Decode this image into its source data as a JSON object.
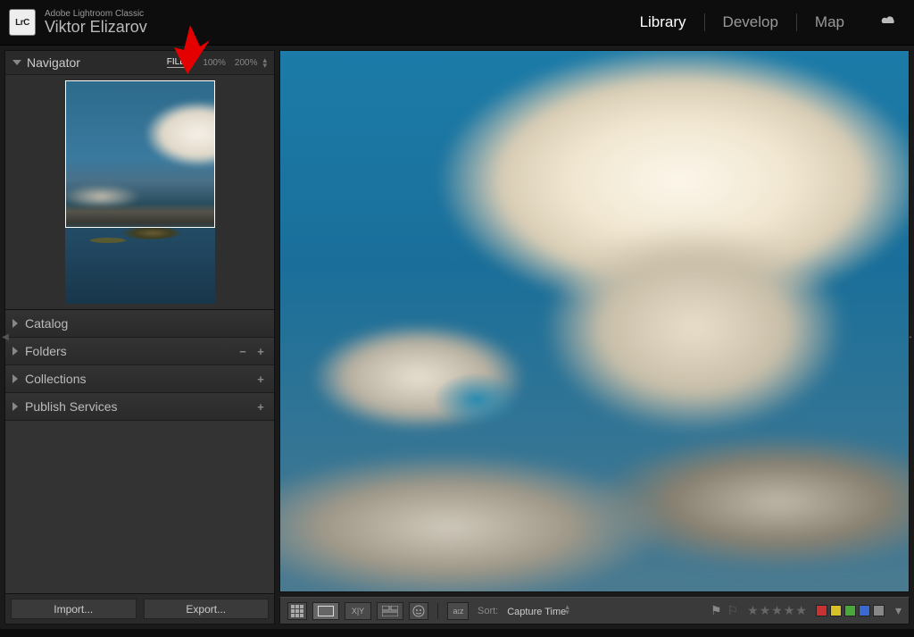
{
  "header": {
    "app_name": "Adobe Lightroom Classic",
    "logo_text": "LrC",
    "user_name": "Viktor Elizarov",
    "modules": [
      {
        "label": "Library",
        "active": true
      },
      {
        "label": "Develop",
        "active": false
      },
      {
        "label": "Map",
        "active": false
      }
    ]
  },
  "navigator": {
    "title": "Navigator",
    "zoom_options": [
      "FILL",
      "100%",
      "200%"
    ],
    "zoom_selected": "FILL"
  },
  "panels": [
    {
      "label": "Catalog",
      "icons": []
    },
    {
      "label": "Folders",
      "icons": [
        "−",
        "+"
      ]
    },
    {
      "label": "Collections",
      "icons": [
        "+"
      ]
    },
    {
      "label": "Publish Services",
      "icons": [
        "+"
      ]
    }
  ],
  "buttons": {
    "import": "Import...",
    "export": "Export..."
  },
  "toolbar": {
    "sort_label": "Sort:",
    "sort_value": "Capture Time",
    "color_swatches": [
      "#c83232",
      "#d8c028",
      "#4aa83a",
      "#3a6ad0",
      "#888888"
    ]
  }
}
